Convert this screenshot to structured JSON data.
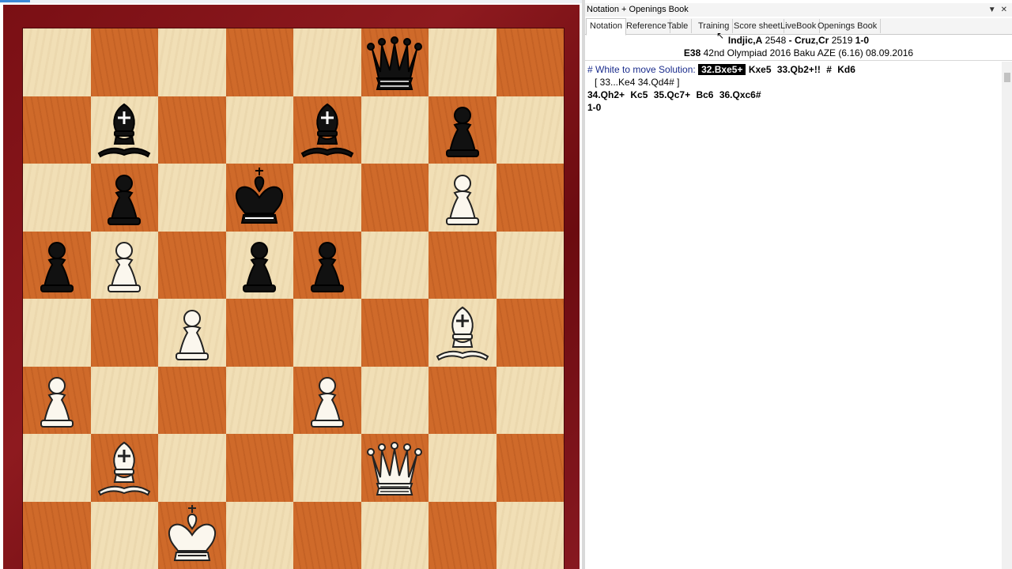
{
  "panel": {
    "title": "Notation + Openings Book",
    "tabs": [
      "Notation",
      "Reference",
      "Table",
      "Training",
      "Score sheet",
      "LiveBook",
      "Openings Book"
    ],
    "active_tab": "Notation"
  },
  "game": {
    "white": "Indjic,A",
    "white_elo": "2548",
    "separator": "-",
    "black": "Cruz,Cr",
    "black_elo": "2519",
    "result": "1-0",
    "eco": "E38",
    "event": "42nd Olympiad 2016 Baku AZE (6.16) 08.09.2016"
  },
  "notation": {
    "comment": "# White to move Solution:",
    "selected_move": "32.Bxe5+",
    "line1_rest": [
      "Kxe5",
      "33.Qb2+!!",
      "#",
      "Kd6"
    ],
    "variation": "[ 33...Ke4  34.Qd4# ]",
    "line3": [
      "34.Qh2+",
      "Kc5",
      "35.Qc7+",
      "Bc6",
      "36.Qxc6#"
    ],
    "result": "1-0"
  },
  "board": {
    "light_color": "#f1dfb6",
    "dark_color": "#cf6a2a",
    "frame_color": "#7a0f14",
    "ranks": [
      [
        "",
        "",
        "",
        "",
        "",
        "bq",
        "",
        ""
      ],
      [
        "",
        "bb",
        "",
        "",
        "bb",
        "",
        "bp",
        ""
      ],
      [
        "",
        "bp",
        "",
        "bk",
        "",
        "",
        "wp",
        ""
      ],
      [
        "bp",
        "wp",
        "",
        "bp",
        "bp",
        "",
        "",
        ""
      ],
      [
        "",
        "",
        "wp",
        "",
        "",
        "",
        "wb",
        ""
      ],
      [
        "wp",
        "",
        "",
        "",
        "wp",
        "",
        "",
        ""
      ],
      [
        "",
        "wb",
        "",
        "",
        "",
        "wq",
        "",
        ""
      ],
      [
        "",
        "",
        "wk",
        "",
        "",
        "",
        "",
        ""
      ]
    ]
  }
}
